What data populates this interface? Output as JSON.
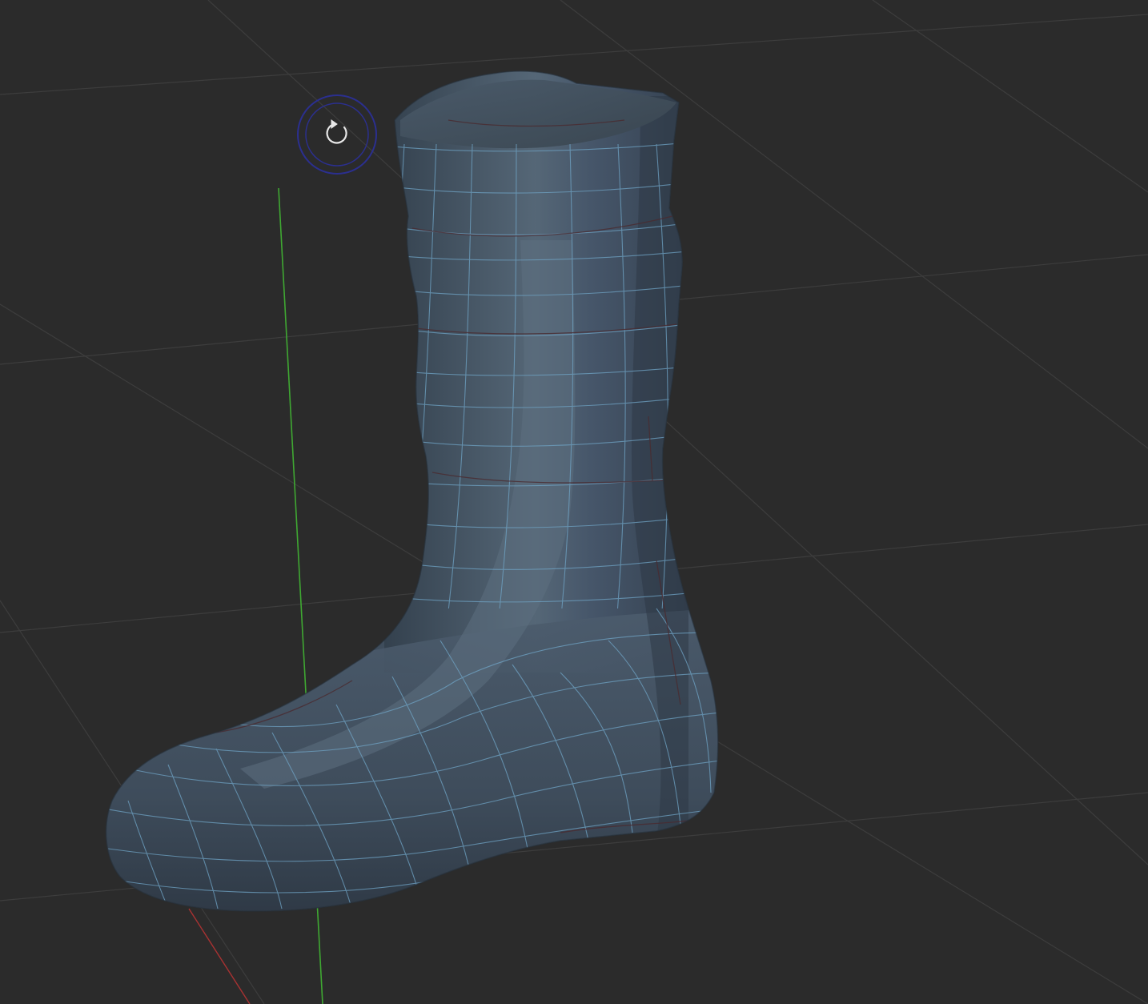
{
  "viewport": {
    "background_color": "#2b2b2b",
    "grid_color": "#3d3d3d",
    "axis_y_color": "#3fa832",
    "axis_x_color": "#a83232",
    "grid_visible": true
  },
  "model": {
    "name_icon": "boot-mesh",
    "base_color": "#3f4d5c",
    "highlight_color": "#5d6f80",
    "shadow_color": "#2e3946",
    "wire_color": "#6fa3c4",
    "seam_color": "#4a2b30"
  },
  "gizmo": {
    "icon": "rotate-icon",
    "ring_color": "#2b2f8f",
    "glyph_color": "#e8e8e8"
  }
}
